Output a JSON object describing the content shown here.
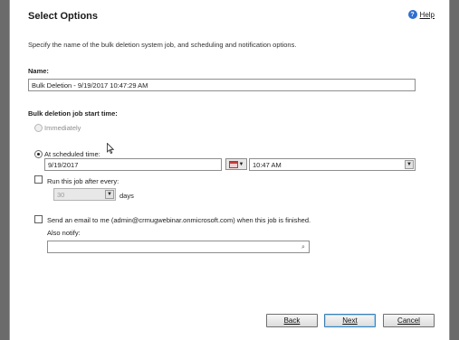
{
  "dialog": {
    "title": "Select Options",
    "help_label": "Help",
    "description": "Specify the name of the bulk deletion system job, and scheduling and notification options."
  },
  "name_field": {
    "label": "Name:",
    "value": "Bulk Deletion - 9/19/2017 10:47:29 AM"
  },
  "start_time": {
    "label": "Bulk deletion job start time:",
    "immediately_label": "Immediately",
    "scheduled_label": "At scheduled time:",
    "date_value": "9/19/2017",
    "time_value": "10:47 AM"
  },
  "recurrence": {
    "label": "Run this job after every:",
    "interval_value": "30",
    "unit_label": "days"
  },
  "notification": {
    "email_label": "Send an email to me (admin@crmugwebinar.onmicrosoft.com) when this job is finished.",
    "also_notify_label": "Also notify:",
    "also_notify_value": ""
  },
  "buttons": {
    "back_label": "Back",
    "next_label": "Next",
    "cancel_label": "Cancel"
  },
  "icons": {
    "help": "question-circle-icon",
    "calendar": "calendar-icon",
    "lookup": "lookup-icon",
    "dropdown": "chevron-down-icon"
  },
  "colors": {
    "help_icon": "#2f6fd0",
    "calendar_icon": "#c43d3d",
    "primary_button_border": "#3c7fb1"
  }
}
